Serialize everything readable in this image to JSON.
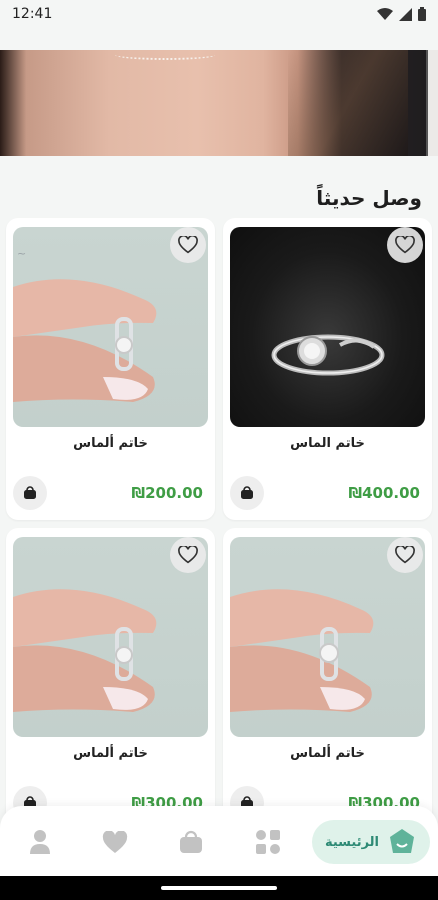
{
  "status_bar": {
    "time": "12:41"
  },
  "section": {
    "title": "وصل حديثاً"
  },
  "products": [
    {
      "name": "خاتم الماس",
      "price": "₪400.00"
    },
    {
      "name": "خاتم ألماس",
      "price": "₪200.00"
    },
    {
      "name": "خاتم ألماس",
      "price": "₪300.00"
    },
    {
      "name": "خاتم ألماس",
      "price": "₪300.00"
    }
  ],
  "nav": {
    "home_label": "الرئيسية"
  },
  "colors": {
    "price": "#3f9d45",
    "accent": "#2e8a75",
    "accent_bg": "#dff2ea"
  }
}
